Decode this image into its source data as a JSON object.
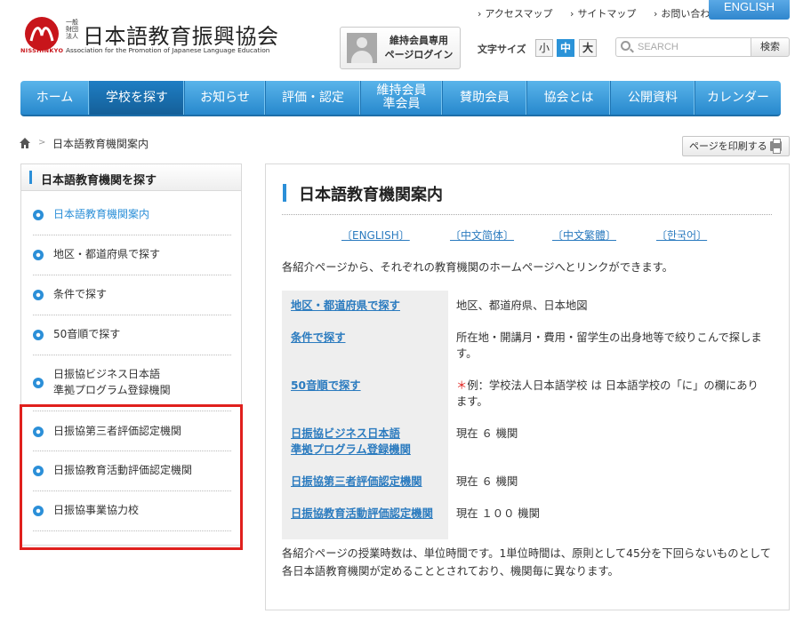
{
  "header": {
    "logo_org": [
      "一般",
      "財団",
      "法人"
    ],
    "logo_title": "日本語教育振興協会",
    "logo_roman": "NISSHINKYO",
    "logo_en": "Association for the Promotion of Japanese Language Education",
    "top_links": [
      "アクセスマップ",
      "サイトマップ",
      "お問い合わせ"
    ],
    "english_label": "ENGLISH",
    "member_login": [
      "維持会員専用",
      "ページログイン"
    ],
    "font_size_label": "文字サイズ",
    "font_sizes": [
      "小",
      "中",
      "大"
    ],
    "font_size_selected": "中",
    "search_placeholder": "SEARCH",
    "search_button": "検索"
  },
  "nav": [
    {
      "label": "ホーム"
    },
    {
      "label": "学校を探す",
      "active": true
    },
    {
      "label": "お知らせ"
    },
    {
      "label": "評価・認定"
    },
    {
      "label": "維持会員\n準会員"
    },
    {
      "label": "賛助会員"
    },
    {
      "label": "協会とは"
    },
    {
      "label": "公開資料"
    },
    {
      "label": "カレンダー"
    }
  ],
  "breadcrumb": {
    "current": "日本語教育機関案内"
  },
  "print_label": "ページを印刷する",
  "sidebar": {
    "heading": "日本語教育機関を探す",
    "items": [
      {
        "label": "日本語教育機関案内",
        "current": true
      },
      {
        "label": "地区・都道府県で探す"
      },
      {
        "label": "条件で探す"
      },
      {
        "label": "50音順で探す"
      },
      {
        "label": "日振協ビジネス日本語\n準拠プログラム登録機関"
      },
      {
        "label": "日振協第三者評価認定機関"
      },
      {
        "label": "日振協教育活動評価認定機関"
      },
      {
        "label": "日振協事業協力校"
      }
    ]
  },
  "main": {
    "title": "日本語教育機関案内",
    "languages": [
      "〔ENGLISH〕",
      "〔中文简体〕",
      "〔中文繁體〕",
      "〔한국어〕"
    ],
    "intro": "各紹介ページから、それぞれの教育機関のホームページへとリンクができます。",
    "rows": [
      {
        "link": "地区・都道府県で探す",
        "desc": "地区、都道府県、日本地図"
      },
      {
        "link": "条件で探す",
        "desc": "所在地・開講月・費用・留学生の出身地等で絞りこんで探します。"
      },
      {
        "link": "50音順で探す",
        "desc_prefix": "＊",
        "desc": "例：学校法人日本語学校 は 日本語学校の「に」の欄にあります。"
      },
      {
        "link": "日振協ビジネス日本語\n準拠プログラム登録機関",
        "desc": "現在 ６ 機関"
      },
      {
        "link": "日振協第三者評価認定機関",
        "desc": "現在 ６ 機関"
      },
      {
        "link": "日振協教育活動評価認定機関",
        "desc": "現在 １００ 機関"
      }
    ],
    "footer_note": "各紹介ページの授業時数は、単位時間です。1単位時間は、原則として45分を下回らないものとして各日本語教育機関が定めることとされており、機関毎に異なります。"
  },
  "colors": {
    "accent": "#2b8fd8",
    "highlight": "#e0201d",
    "logo_red": "#c8151b"
  }
}
